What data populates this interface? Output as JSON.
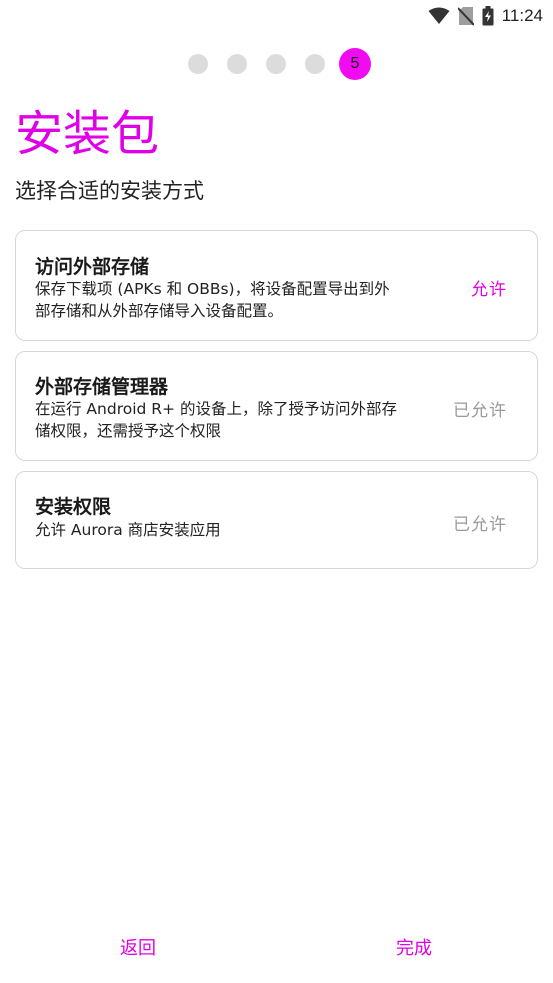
{
  "status_bar": {
    "time": "11:24",
    "icons": [
      "wifi-icon",
      "no-sim-icon",
      "battery-charging-icon"
    ]
  },
  "pager": {
    "total_steps": 5,
    "current_step": 5,
    "current_label": "5"
  },
  "page": {
    "title": "安装包",
    "subtitle": "选择合适的安装方式"
  },
  "permissions": [
    {
      "title": "访问外部存储",
      "description_lines": [
        "保存下载项 (APKs 和 OBBs)，将设备配置导出到外",
        "部存储和从外部存储导入设备配置。"
      ],
      "action": "允许",
      "granted": false
    },
    {
      "title": "外部存储管理器",
      "description_lines": [
        "在运行 Android R+ 的设备上，除了授予访问外部存",
        "储权限，还需授予这个权限"
      ],
      "action": "已允许",
      "granted": true
    },
    {
      "title": "安装权限",
      "description_lines": [
        "允许 Aurora 商店安装应用"
      ],
      "action": "已允许",
      "granted": true
    }
  ],
  "footer": {
    "back_label": "返回",
    "finish_label": "完成"
  },
  "colors": {
    "accent": "#e000e6",
    "active_dot": "#f20af2",
    "inactive_dot": "#dcdcdc",
    "disabled_text": "#9a9a9a",
    "card_border": "#d7d7d7"
  }
}
